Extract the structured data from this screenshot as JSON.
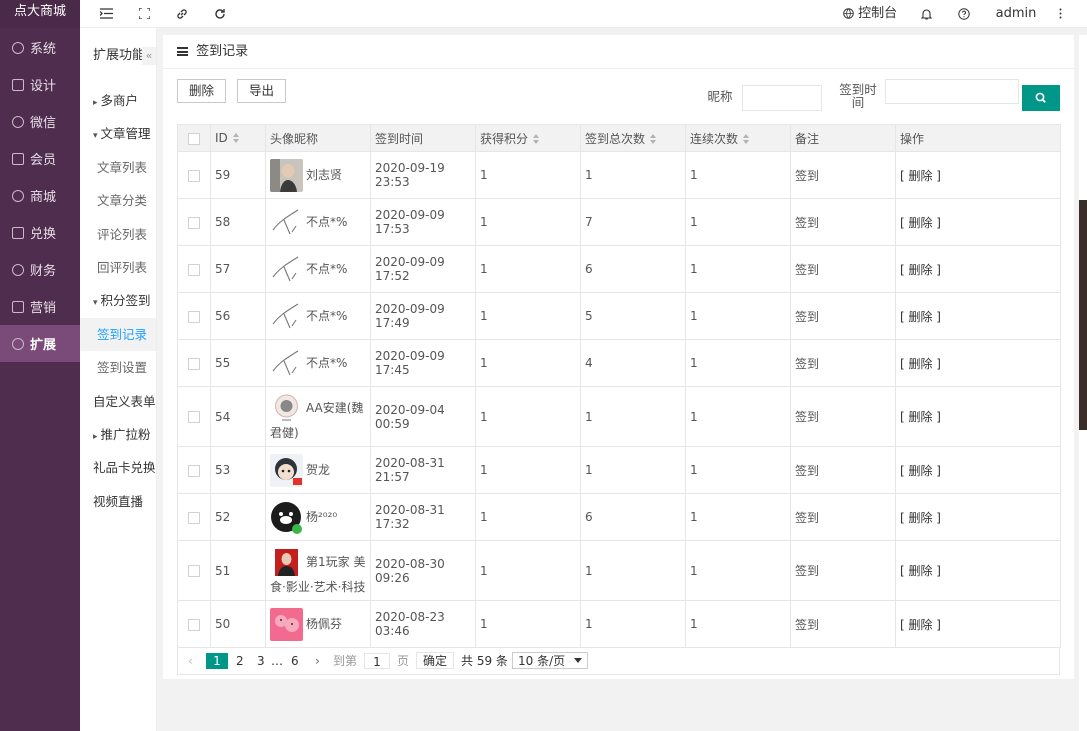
{
  "brand": "点大商城",
  "sidebar": {
    "items": [
      {
        "label": "系统",
        "icon": "gear-icon"
      },
      {
        "label": "设计",
        "icon": "design-icon"
      },
      {
        "label": "微信",
        "icon": "wechat-icon"
      },
      {
        "label": "会员",
        "icon": "user-icon"
      },
      {
        "label": "商城",
        "icon": "shop-icon"
      },
      {
        "label": "兑换",
        "icon": "exchange-icon"
      },
      {
        "label": "财务",
        "icon": "finance-icon"
      },
      {
        "label": "营销",
        "icon": "marketing-icon"
      },
      {
        "label": "扩展",
        "icon": "extend-icon",
        "active": true
      }
    ]
  },
  "topbar": {
    "console": "控制台",
    "user": "admin"
  },
  "subnav": {
    "title": "扩展功能",
    "collapse": "«",
    "items": [
      {
        "label": "多商户",
        "type": "group"
      },
      {
        "label": "文章管理",
        "type": "group-open"
      },
      {
        "label": "文章列表",
        "type": "child"
      },
      {
        "label": "文章分类",
        "type": "child"
      },
      {
        "label": "评论列表",
        "type": "child"
      },
      {
        "label": "回评列表",
        "type": "child"
      },
      {
        "label": "积分签到",
        "type": "group-open"
      },
      {
        "label": "签到记录",
        "type": "child-active"
      },
      {
        "label": "签到设置",
        "type": "child"
      },
      {
        "label": "自定义表单",
        "type": "plain"
      },
      {
        "label": "推广拉粉",
        "type": "group"
      },
      {
        "label": "礼品卡兑换",
        "type": "plain"
      },
      {
        "label": "视频直播",
        "type": "plain"
      }
    ]
  },
  "page": {
    "title": "签到记录",
    "delete_btn": "删除",
    "export_btn": "导出",
    "nickname_label": "昵称",
    "time_label_1": "签到时",
    "time_label_2": "间"
  },
  "table": {
    "headers": [
      "ID",
      "头像昵称",
      "签到时间",
      "获得积分",
      "签到总次数",
      "连续次数",
      "备注",
      "操作"
    ],
    "rows": [
      {
        "id": "59",
        "name": "刘志贤",
        "time": "2020-09-19 23:53",
        "points": "1",
        "total": "1",
        "streak": "1",
        "note": "签到",
        "op": "[ 删除 ]",
        "avatar": "photo"
      },
      {
        "id": "58",
        "name": "不点*%",
        "time": "2020-09-09 17:53",
        "points": "1",
        "total": "7",
        "streak": "1",
        "note": "签到",
        "op": "[ 删除 ]",
        "avatar": "sketch"
      },
      {
        "id": "57",
        "name": "不点*%",
        "time": "2020-09-09 17:52",
        "points": "1",
        "total": "6",
        "streak": "1",
        "note": "签到",
        "op": "[ 删除 ]",
        "avatar": "sketch"
      },
      {
        "id": "56",
        "name": "不点*%",
        "time": "2020-09-09 17:49",
        "points": "1",
        "total": "5",
        "streak": "1",
        "note": "签到",
        "op": "[ 删除 ]",
        "avatar": "sketch"
      },
      {
        "id": "55",
        "name": "不点*%",
        "time": "2020-09-09 17:45",
        "points": "1",
        "total": "4",
        "streak": "1",
        "note": "签到",
        "op": "[ 删除 ]",
        "avatar": "sketch"
      },
      {
        "id": "54",
        "name": "AA安建(魏君健)",
        "time": "2020-09-04 00:59",
        "points": "1",
        "total": "1",
        "streak": "1",
        "note": "签到",
        "op": "[ 删除 ]",
        "avatar": "seal",
        "tall": true
      },
      {
        "id": "53",
        "name": "贺龙",
        "time": "2020-08-31 21:57",
        "points": "1",
        "total": "1",
        "streak": "1",
        "note": "签到",
        "op": "[ 删除 ]",
        "avatar": "cartoon"
      },
      {
        "id": "52",
        "name": "杨²⁰²⁰",
        "time": "2020-08-31 17:32",
        "points": "1",
        "total": "6",
        "streak": "1",
        "note": "签到",
        "op": "[ 删除 ]",
        "avatar": "bear"
      },
      {
        "id": "51",
        "name": "第1玩家 美食·影业·艺术·科技",
        "time": "2020-08-30 09:26",
        "points": "1",
        "total": "1",
        "streak": "1",
        "note": "签到",
        "op": "[ 删除 ]",
        "avatar": "red",
        "tall": true
      },
      {
        "id": "50",
        "name": "杨佩芬",
        "time": "2020-08-23 03:46",
        "points": "1",
        "total": "1",
        "streak": "1",
        "note": "签到",
        "op": "[ 删除 ]",
        "avatar": "pink"
      }
    ]
  },
  "pagination": {
    "prev": "‹",
    "pages": [
      "1",
      "2",
      "3"
    ],
    "ellipsis": "…",
    "last": "6",
    "next": "›",
    "goto_label": "到第",
    "goto_value": "1",
    "page_unit": "页",
    "confirm": "确定",
    "total": "共 59 条",
    "per_page": "10 条/页"
  },
  "colors": {
    "sidebar": "#4f2d4e",
    "sidebar_active": "#7a4a78",
    "accent": "#009688"
  }
}
